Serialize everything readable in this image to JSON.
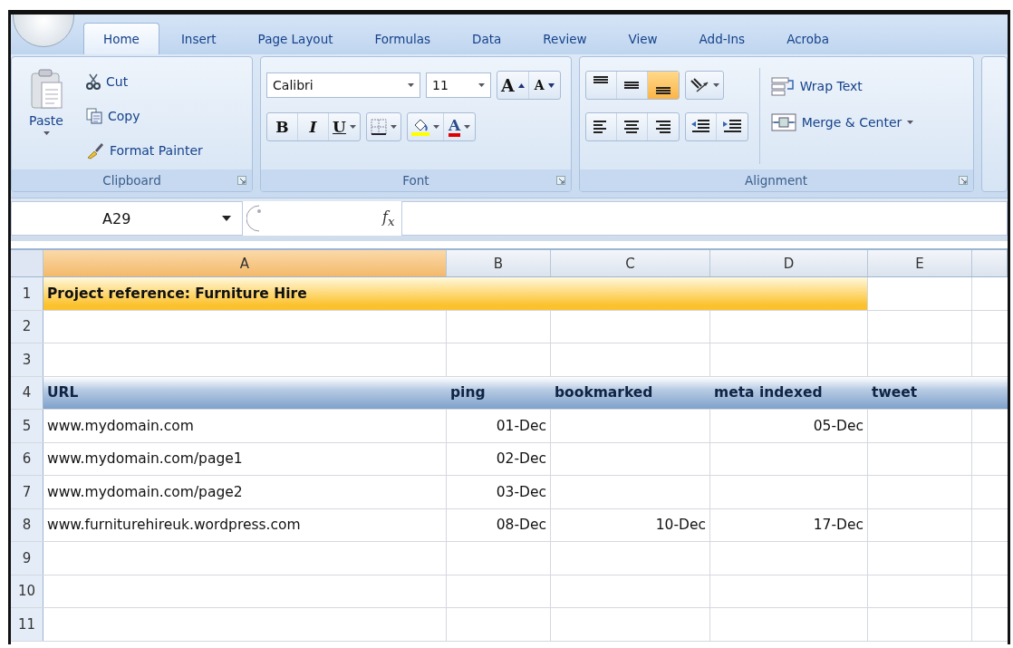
{
  "ribbon": {
    "tabs": [
      {
        "label": "Home",
        "selected": true
      },
      {
        "label": "Insert",
        "selected": false
      },
      {
        "label": "Page Layout",
        "selected": false
      },
      {
        "label": "Formulas",
        "selected": false
      },
      {
        "label": "Data",
        "selected": false
      },
      {
        "label": "Review",
        "selected": false
      },
      {
        "label": "View",
        "selected": false
      },
      {
        "label": "Add-Ins",
        "selected": false
      },
      {
        "label": "Acroba",
        "selected": false
      }
    ],
    "clipboard": {
      "paste": "Paste",
      "cut": "Cut",
      "copy": "Copy",
      "format_painter": "Format Painter",
      "label": "Clipboard"
    },
    "font": {
      "name": "Calibri",
      "size": "11",
      "grow": "A",
      "shrink": "A",
      "bold": "B",
      "italic": "I",
      "underline": "U",
      "font_color": "A",
      "label": "Font"
    },
    "alignment": {
      "vertical": [
        {
          "kind": "top",
          "selected": false
        },
        {
          "kind": "middle",
          "selected": false
        },
        {
          "kind": "bottom",
          "selected": true
        }
      ],
      "horizontal": [
        {
          "kind": "left",
          "selected": false
        },
        {
          "kind": "center",
          "selected": false
        },
        {
          "kind": "right",
          "selected": false
        }
      ],
      "wrap_text": "Wrap Text",
      "merge": "Merge & Center",
      "label": "Alignment"
    }
  },
  "formula_bar": {
    "name_box": "A29",
    "function_label": "f$_{x}$"
  },
  "sheet": {
    "columns": [
      {
        "label": "A",
        "selected": true
      },
      {
        "label": "B",
        "selected": false
      },
      {
        "label": "C",
        "selected": false
      },
      {
        "label": "D",
        "selected": false
      },
      {
        "label": "E",
        "selected": false
      }
    ],
    "rows": [
      {
        "number": "1",
        "kind": "title",
        "cells": [
          "Project reference: Furniture Hire"
        ]
      },
      {
        "number": "2",
        "kind": "blank"
      },
      {
        "number": "3",
        "kind": "blank"
      },
      {
        "number": "4",
        "kind": "header",
        "cells": [
          "URL",
          "ping",
          "bookmarked",
          "meta indexed",
          "tweet"
        ]
      },
      {
        "number": "5",
        "kind": "data",
        "cells": [
          "www.mydomain.com",
          "01-Dec",
          null,
          "05-Dec",
          null
        ]
      },
      {
        "number": "6",
        "kind": "data",
        "cells": [
          "www.mydomain.com/page1",
          "02-Dec",
          null,
          null,
          null
        ]
      },
      {
        "number": "7",
        "kind": "data",
        "cells": [
          "www.mydomain.com/page2",
          "03-Dec",
          null,
          null,
          null
        ]
      },
      {
        "number": "8",
        "kind": "data",
        "cells": [
          "www.furniturehireuk.wordpress.com",
          "08-Dec",
          "10-Dec",
          "17-Dec",
          null
        ]
      },
      {
        "number": "9",
        "kind": "blank"
      },
      {
        "number": "10",
        "kind": "blank"
      },
      {
        "number": "11",
        "kind": "blank"
      }
    ]
  }
}
